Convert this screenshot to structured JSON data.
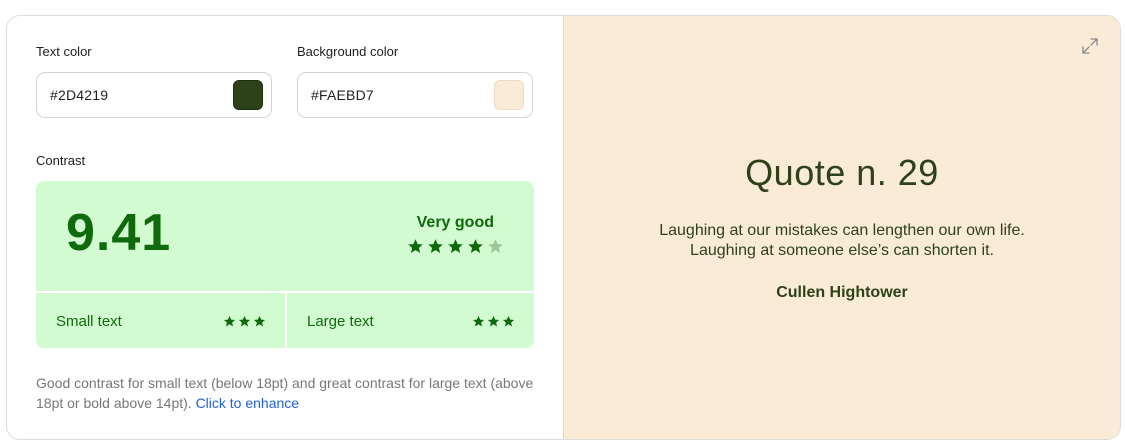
{
  "text_color": {
    "label": "Text color",
    "value": "#2D4219",
    "swatch": "#2D4219"
  },
  "background_color": {
    "label": "Background color",
    "value": "#FAEBD7",
    "swatch": "#FAEBD7"
  },
  "contrast": {
    "label": "Contrast",
    "ratio": "9.41",
    "rating_label": "Very good",
    "rating_stars": 4,
    "rating_max": 5,
    "small_text": {
      "label": "Small text",
      "stars": 3
    },
    "large_text": {
      "label": "Large text",
      "stars": 3
    },
    "description": "Good contrast for small text (below 18pt) and great contrast for large text (above 18pt or bold above 14pt).",
    "enhance_link": "Click to enhance",
    "colors": {
      "box_bg": "#D3FBD2",
      "accent": "#0E6A0B",
      "star_dim": "#9BC79A"
    }
  },
  "preview": {
    "title": "Quote n. 29",
    "quote_line_1": "Laughing at our mistakes can lengthen our own life.",
    "quote_line_2": "Laughing at someone else’s can shorten it.",
    "author": "Cullen Hightower",
    "expand_icon": "expand-icon"
  }
}
